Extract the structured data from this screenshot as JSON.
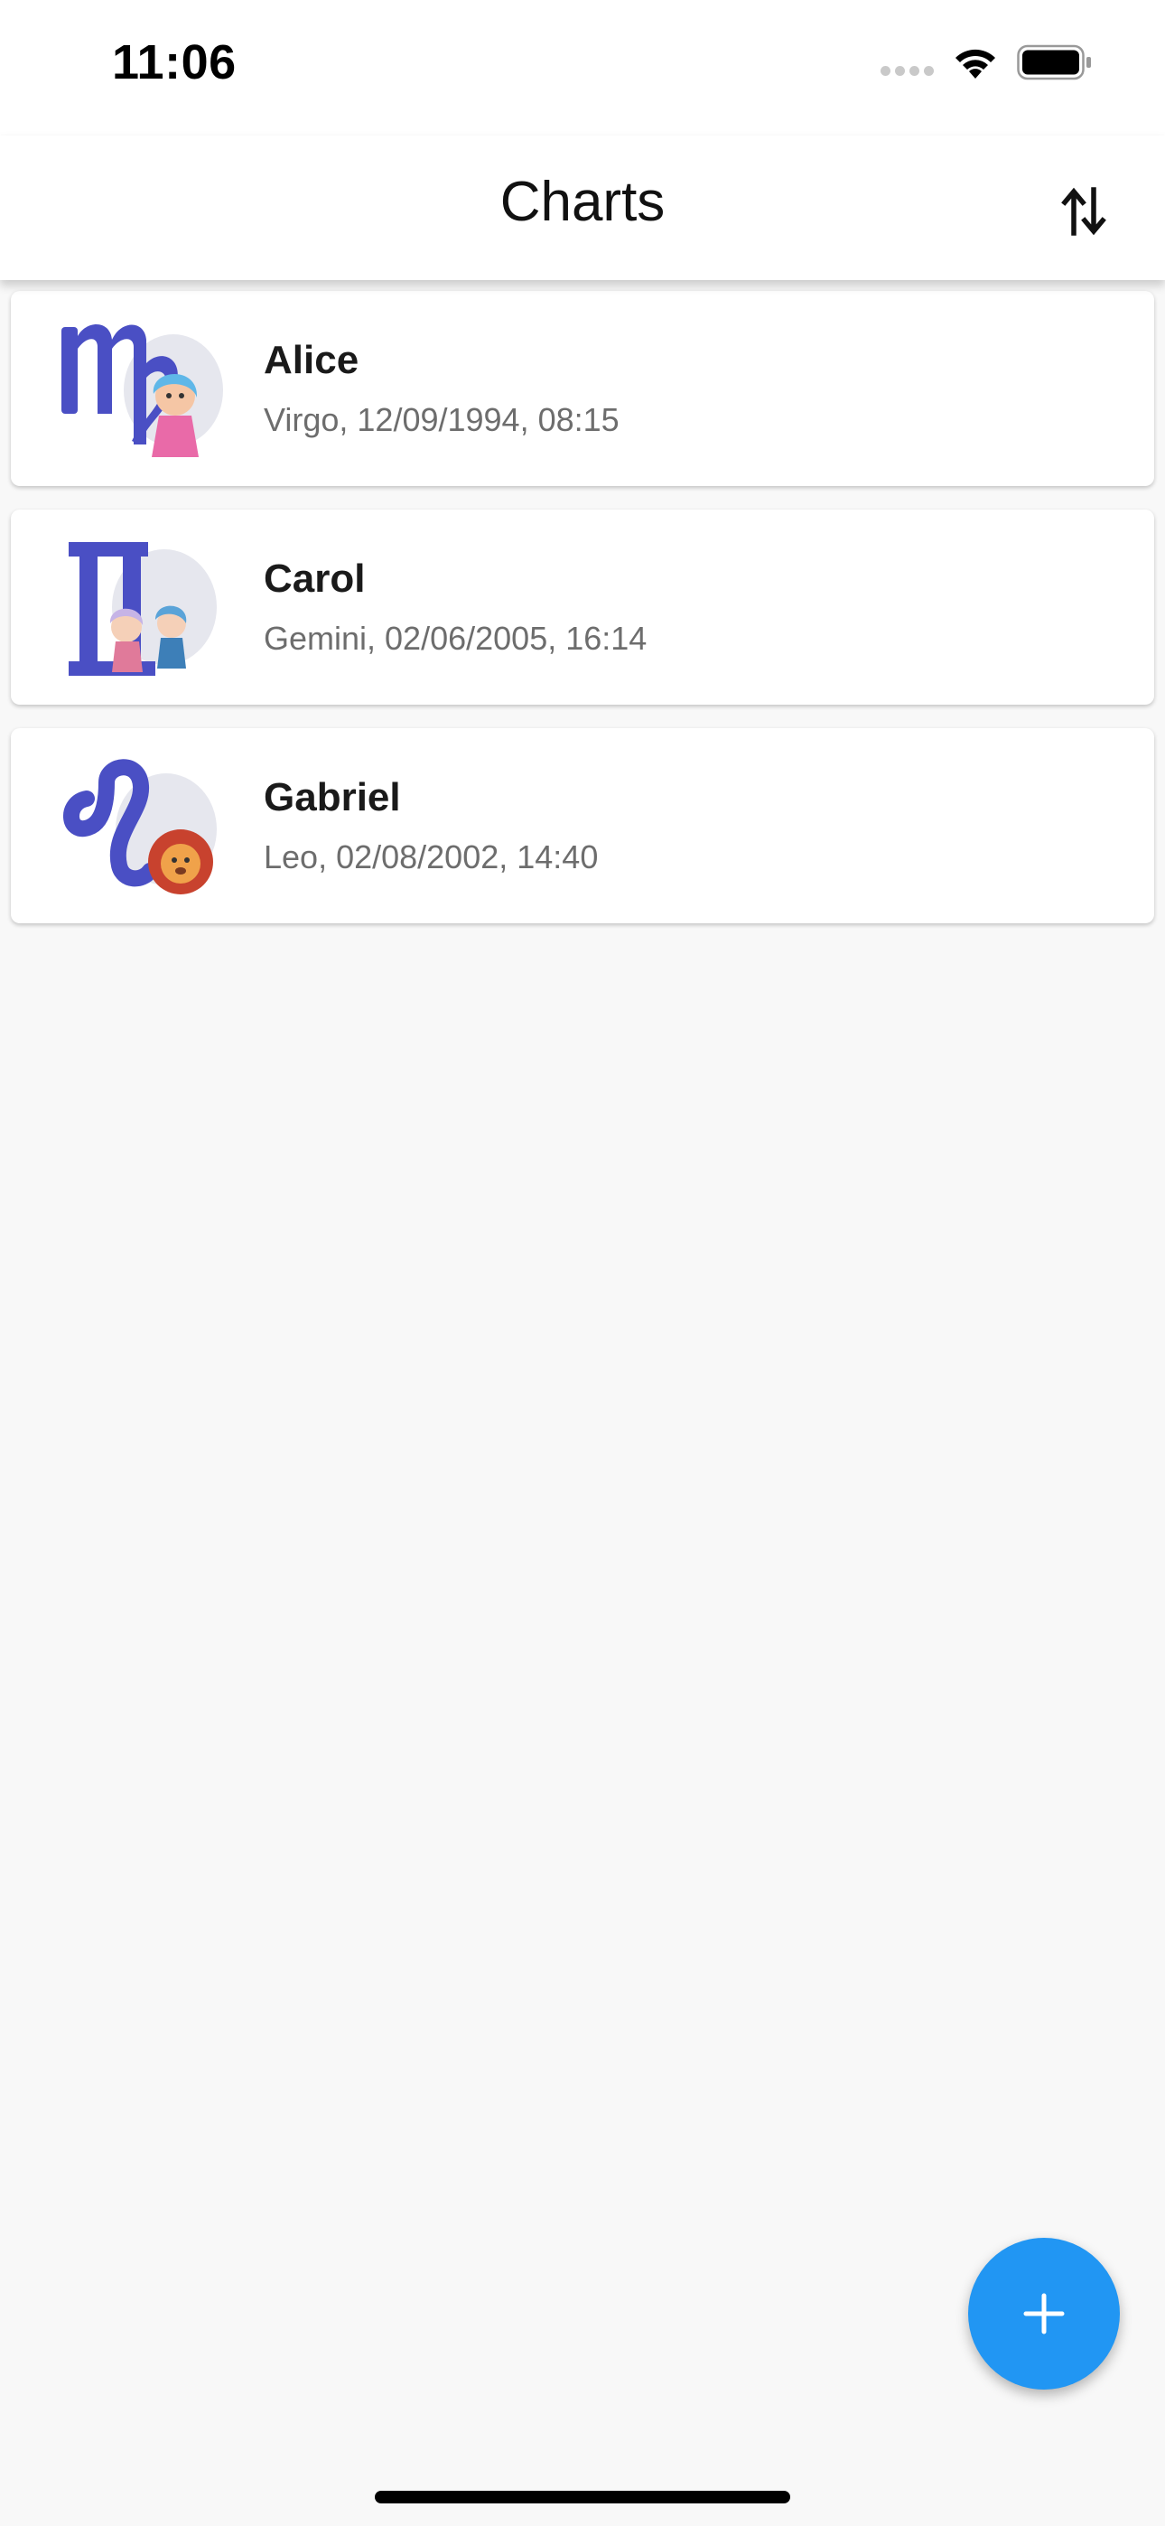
{
  "status_bar": {
    "time": "11:06"
  },
  "app_bar": {
    "title": "Charts",
    "sort_icon": "sort-arrows-icon"
  },
  "charts": [
    {
      "name": "Alice",
      "detail": "Virgo, 12/09/1994, 08:15",
      "sign_icon": "virgo-icon"
    },
    {
      "name": "Carol",
      "detail": "Gemini, 02/06/2005, 16:14",
      "sign_icon": "gemini-icon"
    },
    {
      "name": "Gabriel",
      "detail": "Leo, 02/08/2002, 14:40",
      "sign_icon": "leo-icon"
    }
  ],
  "fab": {
    "icon": "plus-icon"
  },
  "colors": {
    "accent": "#2196f3",
    "glyph": "#4a4fc4",
    "background": "#f8f8f8"
  }
}
